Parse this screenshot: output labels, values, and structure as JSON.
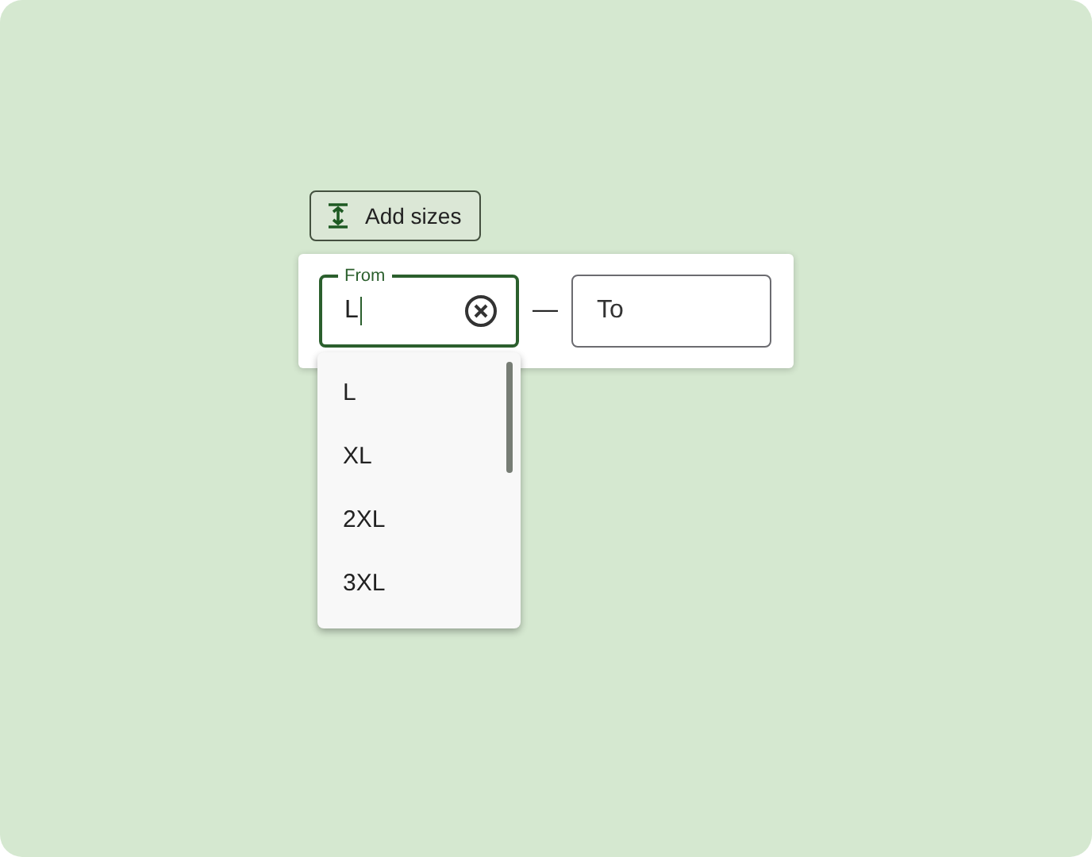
{
  "add_button": {
    "label": "Add sizes"
  },
  "range": {
    "from": {
      "label": "From",
      "value": "L",
      "focused": true
    },
    "separator": "—",
    "to": {
      "placeholder": "To",
      "focused": false
    }
  },
  "dropdown": {
    "options": [
      "L",
      "XL",
      "2XL",
      "3XL"
    ]
  }
}
